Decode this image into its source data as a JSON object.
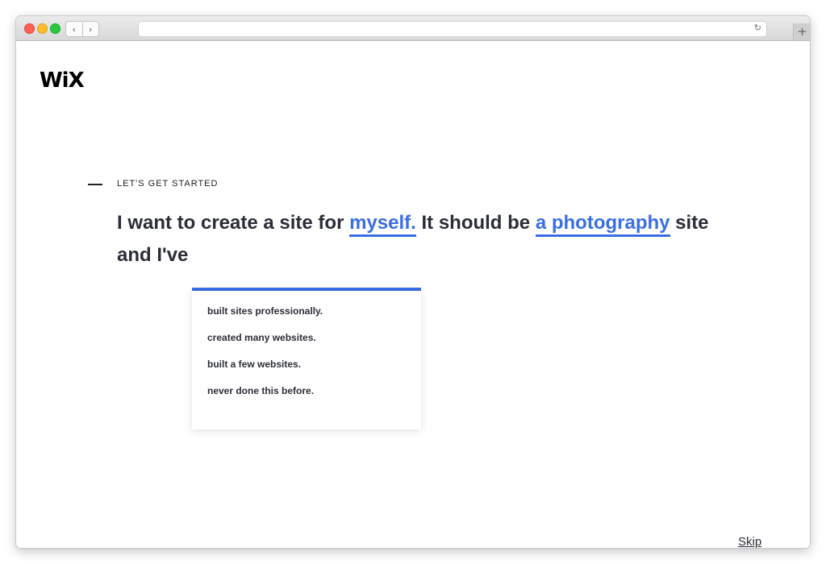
{
  "browser": {
    "back_icon": "chevron-left-icon",
    "forward_icon": "chevron-right-icon",
    "reload_icon": "reload-icon",
    "new_tab_icon": "plus-icon",
    "url": ""
  },
  "logo": {
    "text": "WiX"
  },
  "onboarding": {
    "eyebrow": "LET'S GET STARTED",
    "sentence": {
      "part1": "I want to create a site for",
      "choice_for": "myself.",
      "part2": "It should be",
      "choice_type": "a photography",
      "part3": "site",
      "part4": "and I've"
    },
    "experience_options": [
      "built sites professionally.",
      "created many websites.",
      "built a few websites.",
      "never done this before."
    ]
  },
  "footer": {
    "skip_label": "Skip"
  },
  "colors": {
    "accent": "#3a6ee8",
    "text": "#2b2e38"
  }
}
